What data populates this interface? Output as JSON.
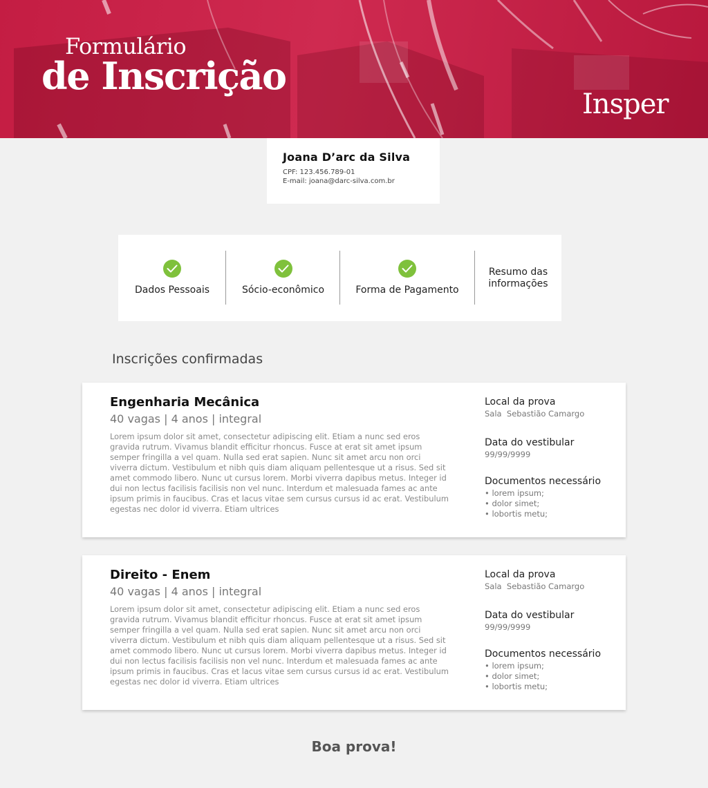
{
  "banner": {
    "title_line1": "Formulário",
    "title_line2": "de Inscrição",
    "brand": "Insper"
  },
  "user": {
    "name": "Joana D’arc da Silva",
    "cpf": "CPF: 123.456.789-01",
    "email": "E-mail: joana@darc-silva.com.br"
  },
  "steps": [
    {
      "label": "Dados Pessoais",
      "done": true
    },
    {
      "label": "Sócio-econômico",
      "done": true
    },
    {
      "label": "Forma de Pagamento",
      "done": true
    },
    {
      "label_line1": "Resumo das",
      "label_line2": "informações",
      "done": false
    }
  ],
  "section_title": "Inscrições confirmadas",
  "courses": [
    {
      "title": "Engenharia Mecânica",
      "meta": "40 vagas | 4 anos | integral",
      "description": "Lorem ipsum dolor sit amet, consectetur adipiscing elit. Etiam a nunc sed eros gravida rutrum. Vivamus blandit efficitur rhoncus. Fusce at erat sit amet ipsum semper fringilla a vel quam. Nulla sed erat sapien. Nunc sit amet arcu non orci viverra dictum. Vestibulum et nibh quis diam aliquam pellentesque ut a risus. Sed sit amet commodo libero. Nunc ut cursus lorem. Morbi viverra dapibus metus. Integer id dui non lectus facilisis facilisis non vel nunc. Interdum et malesuada fames ac ante ipsum primis in faucibus. Cras et lacus vitae sem cursus cursus id ac erat. Vestibulum egestas nec dolor id viverra. Etiam ultrices",
      "local_label": "Local da prova",
      "local_value": "Sala  Sebastião Camargo",
      "date_label": "Data do vestibular",
      "date_value": "99/99/9999",
      "docs_label": "Documentos necessário",
      "docs": [
        "• lorem ipsum;",
        "• dolor simet;",
        "• lobortis metu;"
      ]
    },
    {
      "title": "Direito - Enem",
      "meta": "40 vagas | 4 anos | integral",
      "description": "Lorem ipsum dolor sit amet, consectetur adipiscing elit. Etiam a nunc sed eros gravida rutrum. Vivamus blandit efficitur rhoncus. Fusce at erat sit amet ipsum semper fringilla a vel quam. Nulla sed erat sapien. Nunc sit amet arcu non orci viverra dictum. Vestibulum et nibh quis diam aliquam pellentesque ut a risus. Sed sit amet commodo libero. Nunc ut cursus lorem. Morbi viverra dapibus metus. Integer id dui non lectus facilisis facilisis non vel nunc. Interdum et malesuada fames ac ante ipsum primis in faucibus. Cras et lacus vitae sem cursus cursus id ac erat. Vestibulum egestas nec dolor id viverra. Etiam ultrices",
      "local_label": "Local da prova",
      "local_value": "Sala  Sebastião Camargo",
      "date_label": "Data do vestibular",
      "date_value": "99/99/9999",
      "docs_label": "Documentos necessário",
      "docs": [
        "• lorem ipsum;",
        "• dolor simet;",
        "• lobortis metu;"
      ]
    }
  ],
  "footer_message": "Boa prova!",
  "colors": {
    "brand_red": "#c41d43",
    "check_green": "#7fc13c",
    "background": "#f1f1f1"
  }
}
